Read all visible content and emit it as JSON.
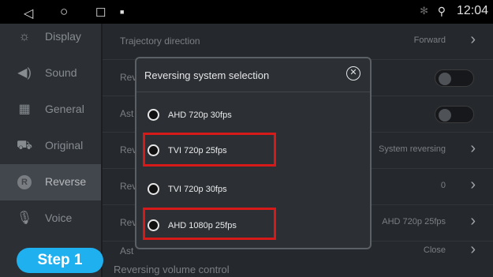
{
  "statusbar": {
    "nav_back": "◁",
    "nav_home": "○",
    "nav_recent": "☐",
    "notification": "■",
    "bluetooth": "✻",
    "location": "⚲",
    "time": "12:04"
  },
  "sidebar": {
    "items": [
      {
        "label": "Display",
        "icon": "display-icon"
      },
      {
        "label": "Sound",
        "icon": "sound-icon"
      },
      {
        "label": "General",
        "icon": "general-icon"
      },
      {
        "label": "Original",
        "icon": "car-icon"
      },
      {
        "label": "Reverse",
        "icon": "reverse-icon"
      },
      {
        "label": "Voice",
        "icon": "microphone-icon"
      }
    ],
    "active": "Reverse"
  },
  "list": {
    "rows": [
      {
        "label": "Trajectory direction",
        "value": "Forward",
        "control": "chevron"
      },
      {
        "label": "Rev",
        "value": "",
        "control": "toggle"
      },
      {
        "label": "Ast",
        "value": "",
        "control": "toggle"
      },
      {
        "label": "Rev",
        "value": "System reversing",
        "control": "chevron"
      },
      {
        "label": "Rev",
        "value": "0",
        "control": "chevron"
      },
      {
        "label": "Rev",
        "value": "AHD 720p 25fps",
        "control": "chevron"
      },
      {
        "label": "Ast",
        "value": "Close",
        "control": "chevron"
      }
    ],
    "bottom_label": "Reversing volume control"
  },
  "dialog": {
    "title": "Reversing system selection",
    "close": "✕",
    "options": [
      {
        "label": "AHD 720p 30fps",
        "highlighted": false
      },
      {
        "label": "TVI 720p 25fps",
        "highlighted": true
      },
      {
        "label": "TVI 720p 30fps",
        "highlighted": false
      },
      {
        "label": "AHD 1080p 25fps",
        "highlighted": true
      }
    ]
  },
  "annotation": {
    "step_label": "Step 1",
    "highlight_color": "#d61a1a",
    "badge_color": "#1fb0f0"
  }
}
